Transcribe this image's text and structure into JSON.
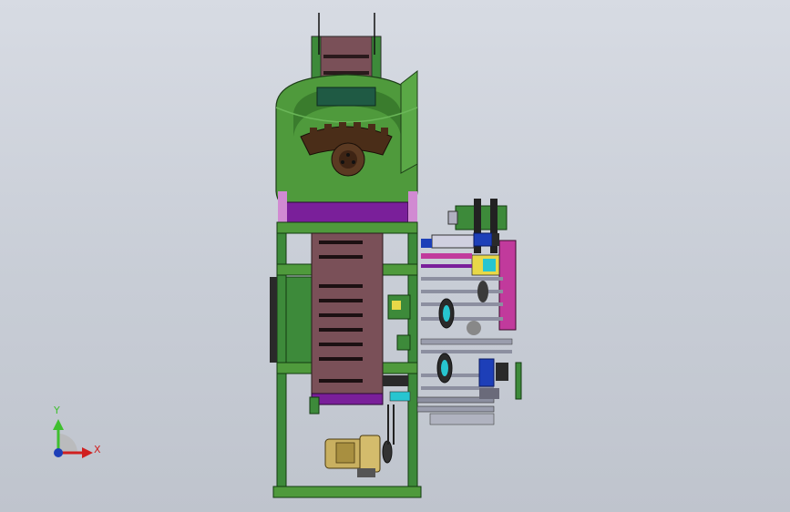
{
  "viewport": {
    "background_top": "#d7dbe3",
    "background_bottom": "#bfc4cd"
  },
  "model": {
    "frame_color": "#3d8a3a",
    "hopper_color": "#4f9a3c",
    "conveyor_color": "#7a5058",
    "purple_accent": "#7a1f9a",
    "motor_color": "#c9b060",
    "magenta_part": "#c13a9c",
    "blue_part": "#1d3fb8"
  },
  "triad": {
    "y_label": "Y",
    "x_label": "X",
    "y_color": "#3fbf2f",
    "x_color": "#d02020",
    "origin_icon": "triad-origin-icon"
  }
}
